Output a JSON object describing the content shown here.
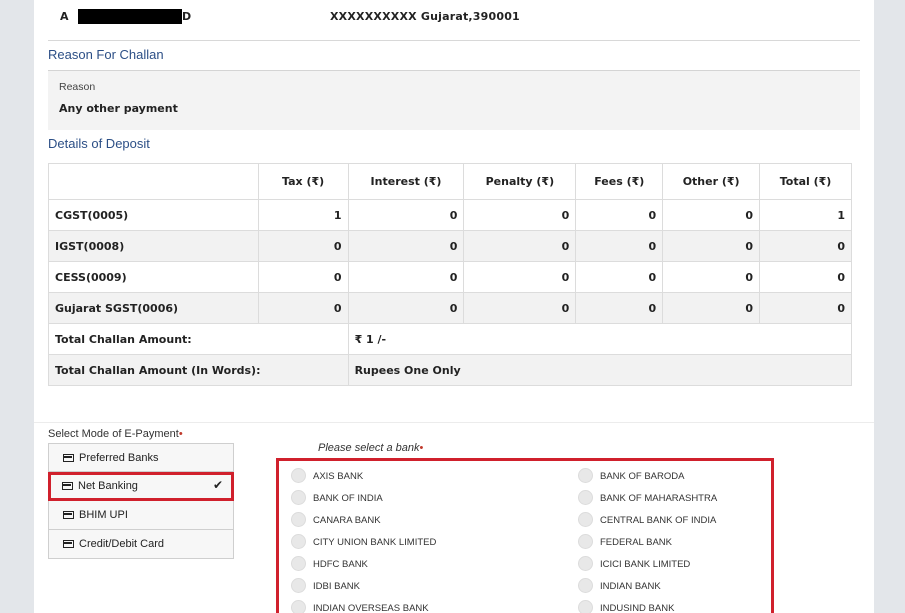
{
  "address": {
    "name_start": "A",
    "name_end": "D",
    "location": "XXXXXXXXXX Gujarat,390001"
  },
  "reason_section": {
    "title": "Reason For Challan",
    "label": "Reason",
    "value": "Any other payment"
  },
  "deposit": {
    "title": "Details of Deposit",
    "headers": [
      "",
      "Tax (₹)",
      "Interest (₹)",
      "Penalty (₹)",
      "Fees (₹)",
      "Other (₹)",
      "Total (₹)"
    ],
    "rows": [
      {
        "name": "CGST(0005)",
        "tax": "1",
        "interest": "0",
        "penalty": "0",
        "fees": "0",
        "other": "0",
        "total": "1"
      },
      {
        "name": "IGST(0008)",
        "tax": "0",
        "interest": "0",
        "penalty": "0",
        "fees": "0",
        "other": "0",
        "total": "0"
      },
      {
        "name": "CESS(0009)",
        "tax": "0",
        "interest": "0",
        "penalty": "0",
        "fees": "0",
        "other": "0",
        "total": "0"
      },
      {
        "name": "Gujarat SGST(0006)",
        "tax": "0",
        "interest": "0",
        "penalty": "0",
        "fees": "0",
        "other": "0",
        "total": "0"
      }
    ],
    "total_label": "Total Challan Amount:",
    "total_value": "₹ 1 /-",
    "words_label": "Total Challan Amount (In Words):",
    "words_value": "Rupees One Only"
  },
  "payment_mode": {
    "label": "Select Mode of E-Payment",
    "required": "•",
    "options": [
      {
        "label": "Preferred Banks",
        "icon": "card-icon"
      },
      {
        "label": "Net Banking",
        "icon": "card-icon",
        "selected_mark": "✔"
      },
      {
        "label": "BHIM UPI",
        "icon": "card-icon"
      },
      {
        "label": "Credit/Debit Card",
        "icon": "card-icon"
      }
    ]
  },
  "banks": {
    "label": "Please select a bank",
    "required": "•",
    "left": [
      "AXIS BANK",
      "BANK OF INDIA",
      "CANARA BANK",
      "CITY UNION BANK LIMITED",
      "HDFC BANK",
      "IDBI BANK",
      "INDIAN OVERSEAS BANK"
    ],
    "right": [
      "BANK OF BARODA",
      "BANK OF MAHARASHTRA",
      "CENTRAL BANK OF INDIA",
      "FEDERAL BANK",
      "ICICI BANK LIMITED",
      "INDIAN BANK",
      "INDUSIND BANK"
    ]
  },
  "colors": {
    "section_title": "#2c4f86",
    "highlight_border": "#d0202c"
  }
}
